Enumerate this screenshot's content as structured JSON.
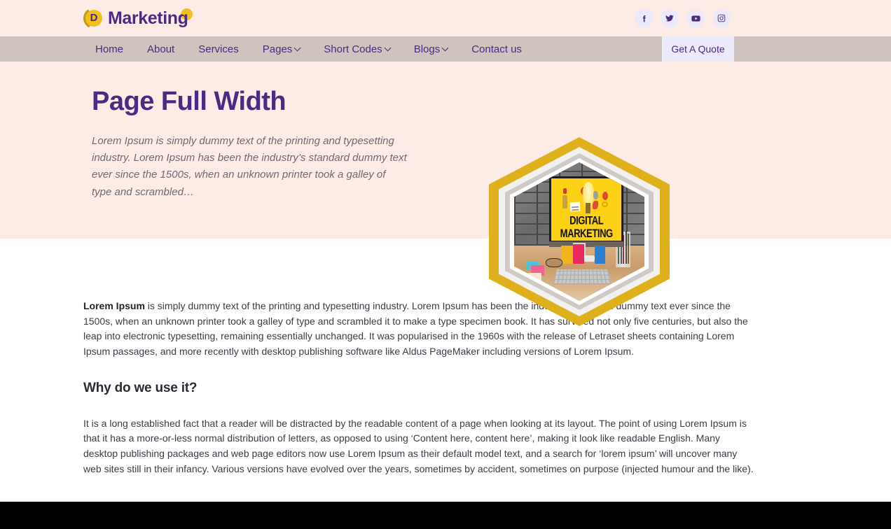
{
  "brand": {
    "logo_letter": "D",
    "logo_text": "Marketing",
    "accent_purple": "#4B2A83",
    "accent_gold": "#EFC01F"
  },
  "topbar": {
    "background": "#FDECE5",
    "socials": [
      {
        "name": "facebook-icon",
        "label": "Facebook"
      },
      {
        "name": "twitter-icon",
        "label": "Twitter"
      },
      {
        "name": "youtube-icon",
        "label": "YouTube"
      },
      {
        "name": "instagram-icon",
        "label": "Instagram"
      }
    ]
  },
  "nav": {
    "background": "#CFC3BE",
    "items": [
      {
        "label": "Home",
        "has_caret": false
      },
      {
        "label": "About",
        "has_caret": false
      },
      {
        "label": "Services",
        "has_caret": false
      },
      {
        "label": "Pages",
        "has_caret": true
      },
      {
        "label": "Short Codes",
        "has_caret": true
      },
      {
        "label": "Blogs",
        "has_caret": true
      },
      {
        "label": "Contact us",
        "has_caret": false
      }
    ],
    "quote_button": {
      "label": "Get A Quote",
      "background": "#ECEAFA"
    }
  },
  "hero": {
    "background": "#FDECE5",
    "title": "Page Full Width",
    "subtitle": "Lorem Ipsum is simply dummy text of the printing and typesetting industry. Lorem Ipsum has been the industry’s standard dummy text ever since the 1500s, when an unknown printer took a galley of type and scrambled…",
    "badge": {
      "shape": "hexagon",
      "border_color": "#DDB01C",
      "inner_border_color": "#FFFFFF",
      "screen_caption": "DIGITAL MARKETING",
      "screen_color": "#FCD116"
    }
  },
  "main": {
    "paragraph_lead": "Lorem Ipsum",
    "paragraph_1": " is simply dummy text of the printing and typesetting industry. Lorem Ipsum has been the industry’s standard dummy text ever since the 1500s, when an unknown printer took a galley of type and scrambled it to make a type specimen book. It has survived not only five centuries, but also the leap into electronic typesetting, remaining essentially unchanged. It was popularised in the 1960s with the release of Letraset sheets containing Lorem Ipsum passages, and more recently with desktop publishing software like Aldus PageMaker including versions of Lorem Ipsum.",
    "section_heading": "Why do we use it?",
    "paragraph_2": "It is a long established fact that a reader will be distracted by the readable content of a page when looking at its layout. The point of using Lorem Ipsum is that it has a more-or-less normal distribution of letters, as opposed to using ‘Content here, content here’, making it look like readable English. Many desktop publishing packages and web page editors now use Lorem Ipsum as their default model text, and a search for ‘lorem ipsum’ will uncover many web sites still in their infancy. Various versions have evolved over the years, sometimes by accident, sometimes on purpose (injected humour and the like)."
  },
  "footer": {
    "background": "#000000"
  }
}
